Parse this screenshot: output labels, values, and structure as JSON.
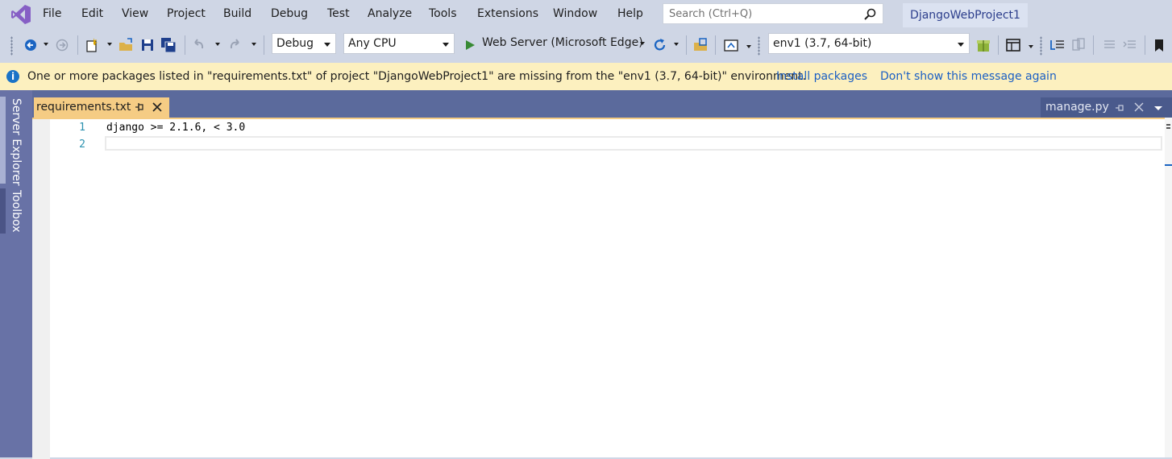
{
  "menu": {
    "items": [
      "File",
      "Edit",
      "View",
      "Project",
      "Build",
      "Debug",
      "Test",
      "Analyze",
      "Tools",
      "Extensions",
      "Window",
      "Help"
    ]
  },
  "search": {
    "placeholder": "Search (Ctrl+Q)"
  },
  "project_name": "DjangoWebProject1",
  "toolbar": {
    "config": "Debug",
    "platform": "Any CPU",
    "run_target": "Web Server (Microsoft Edge)",
    "environment": "env1 (3.7, 64-bit)"
  },
  "infobar": {
    "message": "One or more packages listed in \"requirements.txt\" of project \"DjangoWebProject1\" are missing from the \"env1 (3.7, 64-bit)\" environment.",
    "install_link": "Install packages",
    "dismiss_link": "Don't show this message again"
  },
  "left_rail": {
    "tabs": [
      "Server Explorer",
      "Toolbox"
    ]
  },
  "tabs": {
    "active": "requirements.txt",
    "other": "manage.py"
  },
  "editor": {
    "lines": [
      {
        "number": "1",
        "text": "django >= 2.1.6, < 3.0"
      },
      {
        "number": "2",
        "text": ""
      }
    ]
  },
  "colors": {
    "infobar_bg": "#fcf0bf",
    "active_tab": "#f5cc84",
    "link": "#1b5fc4",
    "accent_vs": "#865fc5"
  }
}
